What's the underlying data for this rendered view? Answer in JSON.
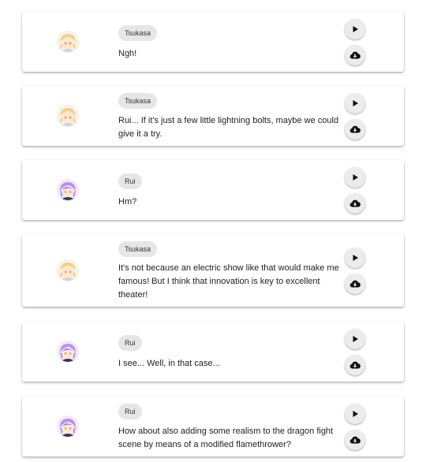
{
  "icons": {
    "play": "play-icon",
    "download": "cloud-download-icon",
    "avatar_tsukasa": "tsukasa-avatar",
    "avatar_rui": "rui-avatar"
  },
  "colors": {
    "card_background": "#ffffff",
    "badge_background": "#e6e6e6",
    "button_background": "#ececec",
    "icon_color": "#111111",
    "tsukasa_hair": "#f2cf8a",
    "rui_hair": "#b98ef0"
  },
  "messages": [
    {
      "speaker": "Tsukasa",
      "text": "Ngh!"
    },
    {
      "speaker": "Tsukasa",
      "text": "Rui... If it's just a few little lightning bolts, maybe we could give it a try."
    },
    {
      "speaker": "Rui",
      "text": "Hm?"
    },
    {
      "speaker": "Tsukasa",
      "text": "It's not because an electric show like that would make me famous! But I think that innovation is key to excellent theater!"
    },
    {
      "speaker": "Rui",
      "text": "I see... Well, in that case..."
    },
    {
      "speaker": "Rui",
      "text": "How about also adding some realism to the dragon fight scene by means of a modified flamethrower?"
    }
  ]
}
